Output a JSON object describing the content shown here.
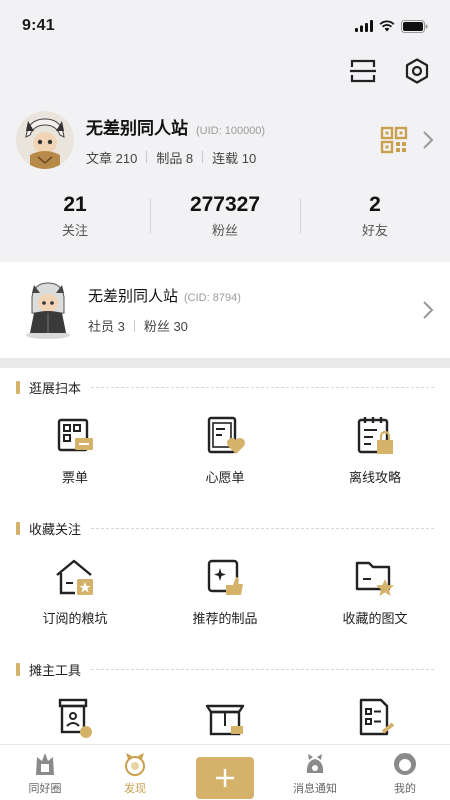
{
  "status": {
    "time": "9:41"
  },
  "toolbar": {
    "scan_icon": "scan-icon",
    "settings_icon": "gear-icon"
  },
  "profile": {
    "name": "无差别同人站",
    "uid": "(UID: 100000)",
    "stats": [
      {
        "label": "文章 210"
      },
      {
        "label": "制品 8"
      },
      {
        "label": "连载 10"
      }
    ]
  },
  "counts": [
    {
      "num": "21",
      "label": "关注"
    },
    {
      "num": "277327",
      "label": "粉丝"
    },
    {
      "num": "2",
      "label": "好友"
    }
  ],
  "club": {
    "name": "无差别同人站",
    "cid": "(CID: 8794)",
    "stats": [
      {
        "label": "社员 3"
      },
      {
        "label": "粉丝 30"
      }
    ]
  },
  "sections": [
    {
      "title": "逛展扫本",
      "items": [
        {
          "label": "票单",
          "icon": "ticket-icon"
        },
        {
          "label": "心愿单",
          "icon": "wishlist-icon"
        },
        {
          "label": "离线攻略",
          "icon": "offline-guide-icon"
        }
      ]
    },
    {
      "title": "收藏关注",
      "items": [
        {
          "label": "订阅的粮坑",
          "icon": "subscribed-icon"
        },
        {
          "label": "推荐的制品",
          "icon": "recommended-icon"
        },
        {
          "label": "收藏的图文",
          "icon": "favorites-icon"
        }
      ]
    },
    {
      "title": "摊主工具",
      "items": [
        {
          "label": "",
          "icon": "booth-icon"
        },
        {
          "label": "",
          "icon": "box-icon"
        },
        {
          "label": "",
          "icon": "list-icon"
        }
      ]
    }
  ],
  "tabbar": [
    {
      "label": "同好圈"
    },
    {
      "label": "发现"
    },
    {
      "label": "+"
    },
    {
      "label": "消息通知"
    },
    {
      "label": "我的"
    }
  ],
  "colors": {
    "accent": "#d4b26a",
    "active": "#c9a04f",
    "background": "#f2f2f4"
  }
}
